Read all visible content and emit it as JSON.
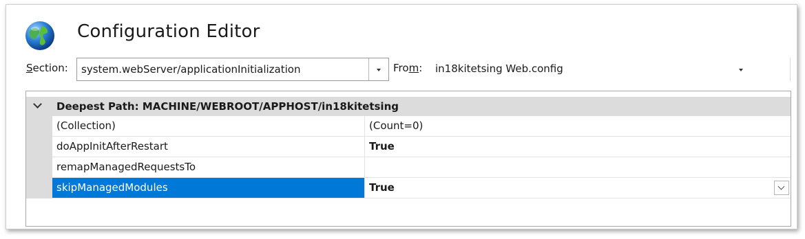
{
  "header": {
    "title": "Configuration Editor",
    "icon": "globe-icon"
  },
  "toolbar": {
    "section_label_prefix": "S",
    "section_label_rest": "ection:",
    "section_value": "system.webServer/applicationInitialization",
    "from_label_prefix": "Fro",
    "from_label_underlined": "m",
    "from_label_suffix": ":",
    "from_value": "in18kitetsing Web.config"
  },
  "grid": {
    "group_title": "Deepest Path: MACHINE/WEBROOT/APPHOST/in18kitetsing",
    "rows": [
      {
        "name": "(Collection)",
        "value": "(Count=0)",
        "bold": false,
        "selected": false
      },
      {
        "name": "doAppInitAfterRestart",
        "value": "True",
        "bold": true,
        "selected": false
      },
      {
        "name": "remapManagedRequestsTo",
        "value": "",
        "bold": false,
        "selected": false
      },
      {
        "name": "skipManagedModules",
        "value": "True",
        "bold": true,
        "selected": true
      }
    ]
  },
  "colors": {
    "selection": "#0078d7",
    "group_header_bg": "#dcdcdc"
  }
}
